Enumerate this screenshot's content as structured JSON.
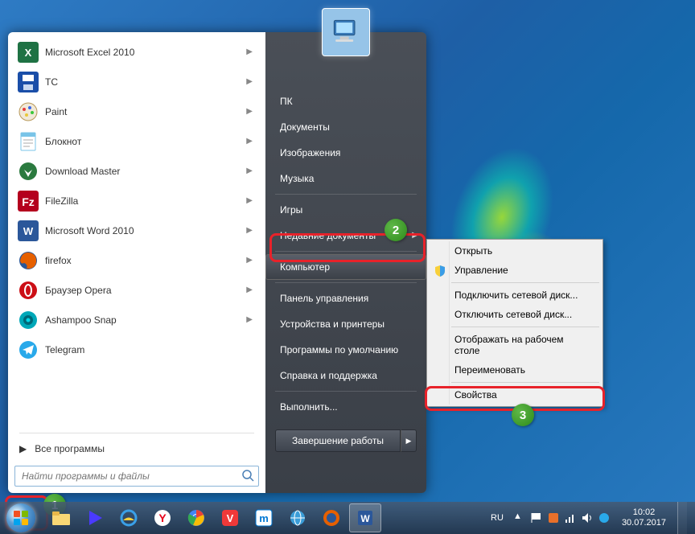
{
  "start_menu": {
    "programs": [
      {
        "label": "Microsoft Excel 2010",
        "icon": "excel",
        "bg": "#1f7244",
        "has_sub": true
      },
      {
        "label": "TC",
        "icon": "floppy",
        "bg": "#1a4ea8",
        "has_sub": true
      },
      {
        "label": "Paint",
        "icon": "paint",
        "bg": "#f0f0f0",
        "has_sub": true
      },
      {
        "label": "Блокнот",
        "icon": "notepad",
        "bg": "#79c4e8",
        "has_sub": true
      },
      {
        "label": "Download Master",
        "icon": "dm",
        "bg": "#2b7a3f",
        "has_sub": true
      },
      {
        "label": "FileZilla",
        "icon": "filezilla",
        "bg": "#b4001e",
        "has_sub": true
      },
      {
        "label": "Microsoft Word 2010",
        "icon": "word",
        "bg": "#2b579a",
        "has_sub": true
      },
      {
        "label": "firefox",
        "icon": "firefox",
        "bg": "#e66000",
        "has_sub": true
      },
      {
        "label": "Браузер Opera",
        "icon": "opera",
        "bg": "#cc0f16",
        "has_sub": true
      },
      {
        "label": "Ashampoo Snap",
        "icon": "snap",
        "bg": "#00a8b8",
        "has_sub": true
      },
      {
        "label": "Telegram",
        "icon": "telegram",
        "bg": "#29a9ea",
        "has_sub": false
      }
    ],
    "all_programs": "Все программы",
    "search_placeholder": "Найти программы и файлы"
  },
  "right_panel": {
    "items": [
      {
        "label": "ПК",
        "key": "user"
      },
      {
        "label": "Документы",
        "key": "docs"
      },
      {
        "label": "Изображения",
        "key": "pics"
      },
      {
        "label": "Музыка",
        "key": "music"
      },
      {
        "label": "Игры",
        "key": "games"
      },
      {
        "label": "Недавние документы",
        "key": "recent",
        "has_sub": true
      },
      {
        "label": "Компьютер",
        "key": "computer",
        "highlighted": true
      },
      {
        "label": "Панель управления",
        "key": "cpanel"
      },
      {
        "label": "Устройства и принтеры",
        "key": "devices"
      },
      {
        "label": "Программы по умолчанию",
        "key": "defaults"
      },
      {
        "label": "Справка и поддержка",
        "key": "help"
      },
      {
        "label": "Выполнить...",
        "key": "run"
      }
    ],
    "shutdown": "Завершение работы"
  },
  "context_menu": {
    "items": [
      {
        "label": "Открыть"
      },
      {
        "label": "Управление",
        "icon": "shield"
      },
      {
        "sep": true
      },
      {
        "label": "Подключить сетевой диск..."
      },
      {
        "label": "Отключить сетевой диск..."
      },
      {
        "sep": true
      },
      {
        "label": "Отображать на рабочем столе"
      },
      {
        "label": "Переименовать"
      },
      {
        "sep": true
      },
      {
        "label": "Свойства",
        "highlighted": true
      }
    ]
  },
  "callouts": {
    "1": "1",
    "2": "2",
    "3": "3"
  },
  "taskbar": {
    "lang": "RU",
    "time": "10:02",
    "date": "30.07.2017"
  }
}
